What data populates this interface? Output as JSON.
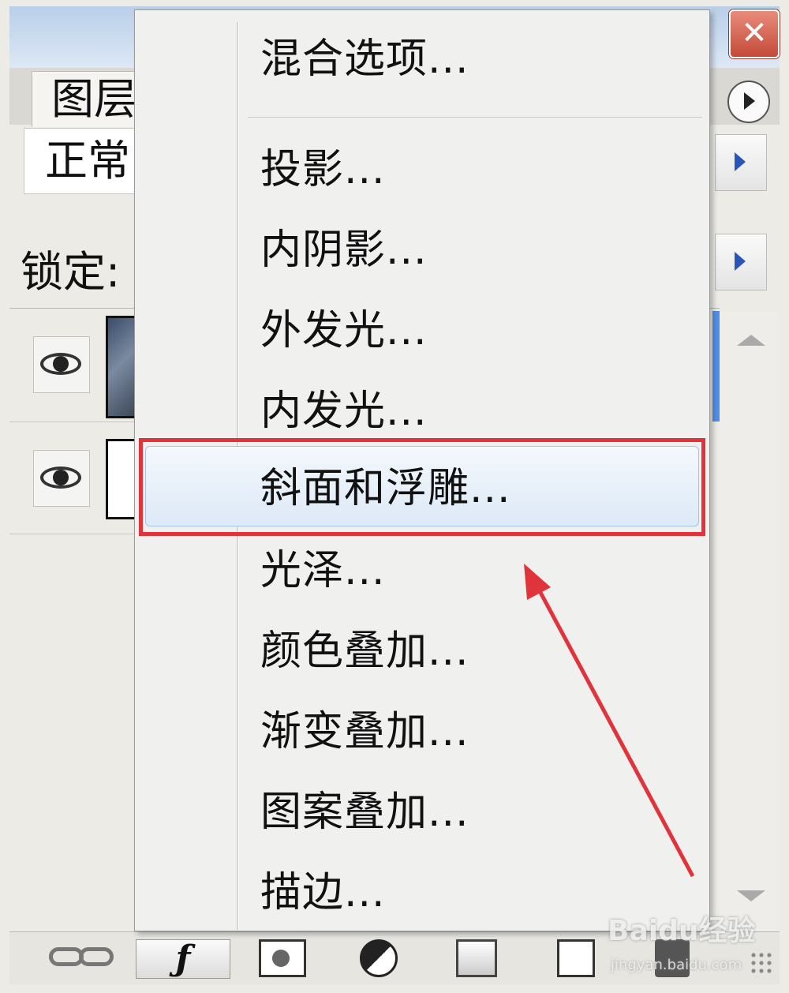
{
  "window": {
    "close_label": "✕"
  },
  "panel": {
    "tab_label": "图层",
    "blend_mode": "正常",
    "lock_label": "锁定:"
  },
  "menu": {
    "items": [
      {
        "label": "混合选项..."
      },
      {
        "label": "投影..."
      },
      {
        "label": "内阴影..."
      },
      {
        "label": "外发光..."
      },
      {
        "label": "内发光..."
      },
      {
        "label": "斜面和浮雕...",
        "highlighted": true
      },
      {
        "label": "光泽..."
      },
      {
        "label": "颜色叠加..."
      },
      {
        "label": "渐变叠加..."
      },
      {
        "label": "图案叠加..."
      },
      {
        "label": "描边..."
      }
    ]
  },
  "bottom_tools": {
    "fx_label": "ƒ"
  },
  "watermark": {
    "brand": "Baidu经验",
    "url": "jingyan.baidu.com"
  },
  "annotation_color": "#e1333b",
  "highlight_color": "#dde9f7"
}
